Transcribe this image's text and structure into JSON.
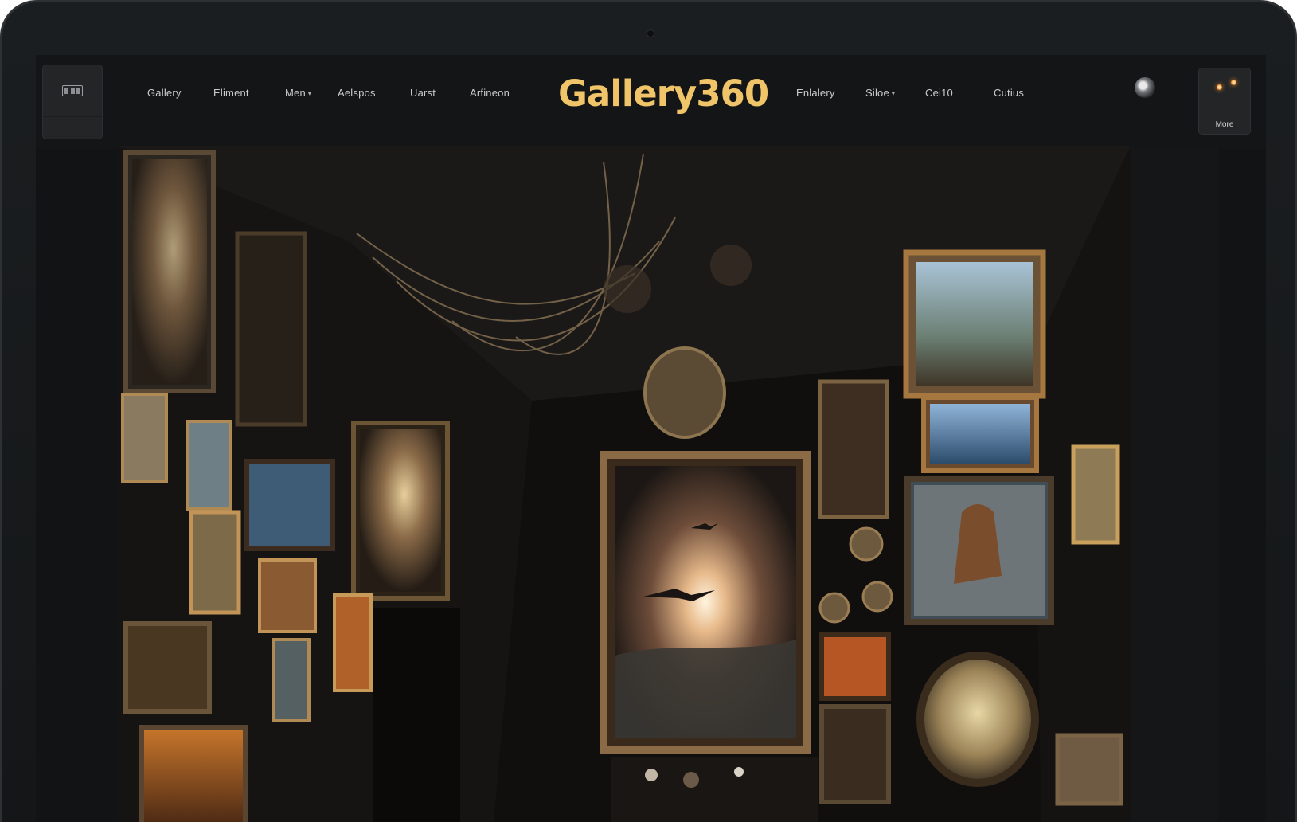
{
  "window": {
    "brand": "Gallery360"
  },
  "header": {
    "menu_icon": "grid-icon",
    "nav_left": [
      {
        "label": "Gallery",
        "has_dropdown": false
      },
      {
        "label": "Eliment",
        "has_dropdown": false
      },
      {
        "label": "Men",
        "has_dropdown": true
      },
      {
        "label": "Aelspos",
        "has_dropdown": false
      },
      {
        "label": "Uarst",
        "has_dropdown": false
      },
      {
        "label": "Arfineon",
        "has_dropdown": false
      }
    ],
    "nav_right": [
      {
        "label": "Enlalery",
        "has_dropdown": false
      },
      {
        "label": "Siloe",
        "has_dropdown": true
      },
      {
        "label": "Cei10",
        "has_dropdown": false
      },
      {
        "label": "Cutius",
        "has_dropdown": false
      }
    ],
    "profile_icon": "user-avatar-icon",
    "more_label": "More",
    "more_icon": "dots-icon",
    "dropdown_caret": "▾"
  },
  "hero": {
    "image_icon": "gallery-room-artwork"
  },
  "colors": {
    "brand": "#f0c468",
    "background": "#141516",
    "tile": "#232527",
    "nav_text": "#c9cbcd"
  }
}
